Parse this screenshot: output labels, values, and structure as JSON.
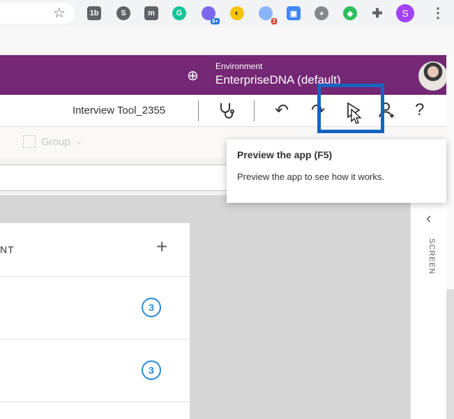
{
  "browser": {
    "extensions": [
      {
        "icon": "extension-1b-icon",
        "text": "1b",
        "color": "#5f6368"
      },
      {
        "icon": "skype-icon",
        "text": "S",
        "color": "#5f6368"
      },
      {
        "icon": "bookmark-icon",
        "text": "m",
        "color": "#5f6368"
      },
      {
        "icon": "grammarly-icon",
        "text": "G",
        "color": "#15c39a"
      },
      {
        "icon": "extension-badge-icon",
        "text": "",
        "color": "#7b68ee",
        "badge": "9+",
        "badge_color": "#1a73e8"
      },
      {
        "icon": "extension-yellow-icon",
        "text": "◐",
        "color": "#222"
      },
      {
        "icon": "extension-red-icon",
        "text": "◆",
        "color": "#8ab4f8",
        "badge": "3",
        "badge_color": "#d93025"
      },
      {
        "icon": "clipboard-icon",
        "text": "▣",
        "color": "#4285f4"
      },
      {
        "icon": "dog-icon",
        "text": "◕",
        "color": "#777"
      },
      {
        "icon": "evernote-icon",
        "text": "◆",
        "color": "#2dbe60"
      },
      {
        "icon": "puzzle-icon",
        "text": "✚",
        "color": "#5f6368"
      }
    ],
    "profile_letter": "S",
    "profile_color": "#a142f4"
  },
  "header": {
    "environment_label": "Environment",
    "environment_name": "EnterpriseDNA (default)",
    "brand_color": "#742774"
  },
  "toolbar": {
    "app_name": "Interview Tool_2355"
  },
  "cmdbar": {
    "group_label": "Group"
  },
  "panel": {
    "title": "NT",
    "rows": [
      {
        "count": "3"
      },
      {
        "count": "3"
      }
    ]
  },
  "right_pane": {
    "vertical_label": "SCREEN"
  },
  "tooltip": {
    "title": "Preview the app (F5)",
    "description": "Preview the app to see how it works."
  }
}
